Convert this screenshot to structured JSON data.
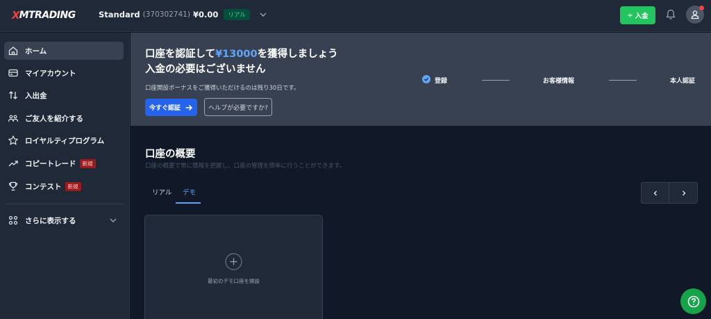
{
  "header": {
    "logo_x": "X",
    "logo_word": "MTRADING",
    "account_name": "Standard",
    "account_number": "(370302741)",
    "balance": "¥0.00",
    "account_type_badge": "リアル",
    "deposit_button": "入金"
  },
  "sidebar": {
    "items": [
      {
        "label": "ホーム",
        "icon": "home-icon"
      },
      {
        "label": "マイアカウント",
        "icon": "account-card-icon"
      },
      {
        "label": "入出金",
        "icon": "transfer-arrows-icon"
      },
      {
        "label": "ご友人を紹介する",
        "icon": "referral-people-icon"
      },
      {
        "label": "ロイヤルティプログラム",
        "icon": "star-icon"
      },
      {
        "label": "コピートレード",
        "icon": "trend-up-icon",
        "badge": "新規"
      },
      {
        "label": "コンテスト",
        "icon": "trophy-icon",
        "badge": "新規"
      }
    ],
    "more_label": "さらに表示する"
  },
  "banner": {
    "title_prefix": "口座を認証して",
    "title_amount": "¥13000",
    "title_suffix": "を獲得しましょう",
    "title_line2": "入金の必要はございません",
    "subtitle": "口座開設ボーナスをご獲得いただけるのは残り30日です。",
    "verify_button": "今すぐ認証",
    "help_button": "ヘルプが必要ですか?",
    "steps": [
      "登録",
      "お客様情報",
      "本人認証"
    ],
    "accent_color": "#60a5fa"
  },
  "main": {
    "title": "口座の概要",
    "subtitle": "口座の概要で常に情報を把握し、口座の管理を簡単に行うことができます。",
    "tabs": [
      "リアル",
      "デモ"
    ],
    "active_tab": "デモ",
    "demo_card_label": "最初のデモ口座を開設"
  },
  "colors": {
    "deposit_green": "#22c55e",
    "verify_blue": "#2563eb",
    "new_badge": "#991b1b"
  }
}
